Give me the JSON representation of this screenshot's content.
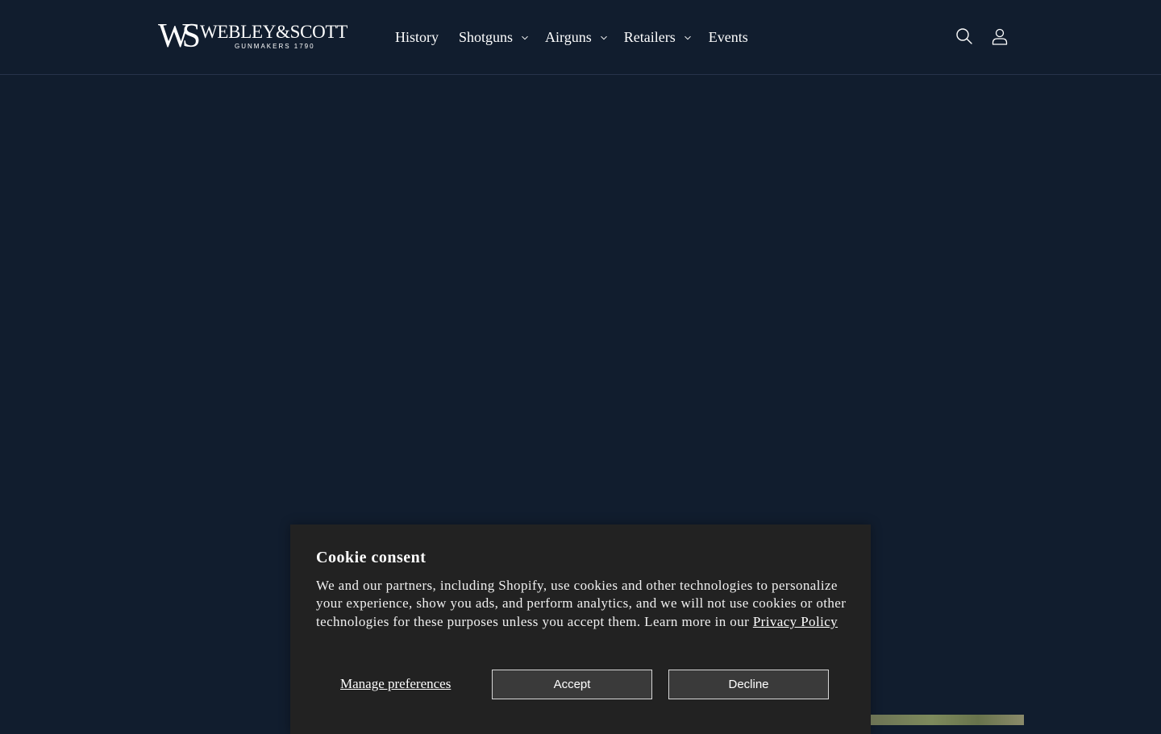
{
  "header": {
    "logo": {
      "mark": "WS",
      "name": "WEBLEY&SCOTT",
      "tagline": "GUNMAKERS 1790"
    },
    "nav": [
      {
        "label": "History",
        "has_dropdown": false
      },
      {
        "label": "Shotguns",
        "has_dropdown": true
      },
      {
        "label": "Airguns",
        "has_dropdown": true
      },
      {
        "label": "Retailers",
        "has_dropdown": true
      },
      {
        "label": "Events",
        "has_dropdown": false
      }
    ],
    "icons": [
      "search-icon",
      "account-icon"
    ]
  },
  "cookie_banner": {
    "title": "Cookie consent",
    "body": "We and our partners, including Shopify, use cookies and other technologies to personalize your experience, show you ads, and perform analytics, and we will not use cookies or other technologies for these purposes unless you accept them. Learn more in our",
    "privacy_link": "Privacy Policy",
    "manage_label": "Manage preferences",
    "accept_label": "Accept",
    "decline_label": "Decline"
  },
  "colors": {
    "page_background": "#111d2e",
    "banner_background": "#222222",
    "text": "#ffffff"
  }
}
